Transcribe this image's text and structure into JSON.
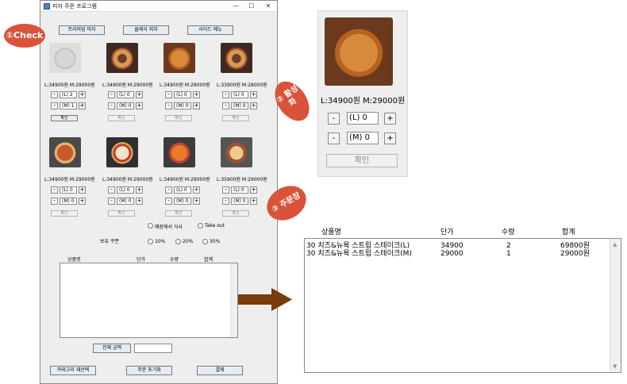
{
  "window": {
    "title": "피자 주문 프로그램",
    "controls": {
      "minimize": "—",
      "maximize": "☐",
      "close": "✕"
    }
  },
  "category_buttons": [
    "프리미엄 피자",
    "클래식 피자",
    "사이드 메뉴"
  ],
  "products": [
    {
      "price_text": "L:34900원 M:29000원",
      "qty_l": "(L) 2",
      "qty_m": "(M) 1",
      "confirm": "확인",
      "active": true
    },
    {
      "price_text": "L:34900원 M:29000원",
      "qty_l": "(L) 0",
      "qty_m": "(M) 0",
      "confirm": "확인",
      "active": false
    },
    {
      "price_text": "L:34900원 M:29000원",
      "qty_l": "(L) 0",
      "qty_m": "(M) 0",
      "confirm": "확인",
      "active": false
    },
    {
      "price_text": "L:33900원 M:28000원",
      "qty_l": "(L) 0",
      "qty_m": "(M) 0",
      "confirm": "확인",
      "active": false
    },
    {
      "price_text": "L:34900원 M:29000원",
      "qty_l": "(L) 0",
      "qty_m": "(M) 0",
      "confirm": "확인",
      "active": false
    },
    {
      "price_text": "L:34900원 M:29000원",
      "qty_l": "(L) 0",
      "qty_m": "(M) 0",
      "confirm": "확인",
      "active": false
    },
    {
      "price_text": "L:34900원 M:29000원",
      "qty_l": "(L) 0",
      "qty_m": "(M) 0",
      "confirm": "확인",
      "active": false
    },
    {
      "price_text": "L:35900원 M:29000원",
      "qty_l": "(L) 0",
      "qty_m": "(M) 0",
      "confirm": "확인",
      "active": false
    }
  ],
  "minus": "-",
  "plus": "+",
  "dine": {
    "in": "매장에서 식사",
    "out": "Take out"
  },
  "coupon": {
    "label": "보유 쿠폰",
    "options": [
      "10%",
      "20%",
      "30%"
    ]
  },
  "order_table_small": {
    "headers": [
      "상품명",
      "단가",
      "수량",
      "합계"
    ]
  },
  "total_label": "전체 금액",
  "total_value": "",
  "bottom_buttons": [
    "카테고리 재선택",
    "주문 초기화",
    "결제"
  ],
  "annotations": {
    "check": "①Check",
    "activate": "② 활성화",
    "order_window": "③ 주문창"
  },
  "zoom": {
    "price_text": "L:34900원 M:29000원",
    "qty_l": "(L) 0",
    "qty_m": "(M) 0",
    "confirm": "확인"
  },
  "order_window": {
    "headers": [
      "상품명",
      "단가",
      "수량",
      "합계"
    ],
    "rows": [
      {
        "name": "30 치즈&뉴욕 스트립 스테이크(L)",
        "price": "34900",
        "qty": "2",
        "total": "69800원"
      },
      {
        "name": "30 치즈&뉴욕 스트립 스테이크(M)",
        "price": "29000",
        "qty": "1",
        "total": "29000원"
      }
    ]
  },
  "colors": {
    "annotation": "#d9533a",
    "arrow": "#7a3a0a"
  }
}
